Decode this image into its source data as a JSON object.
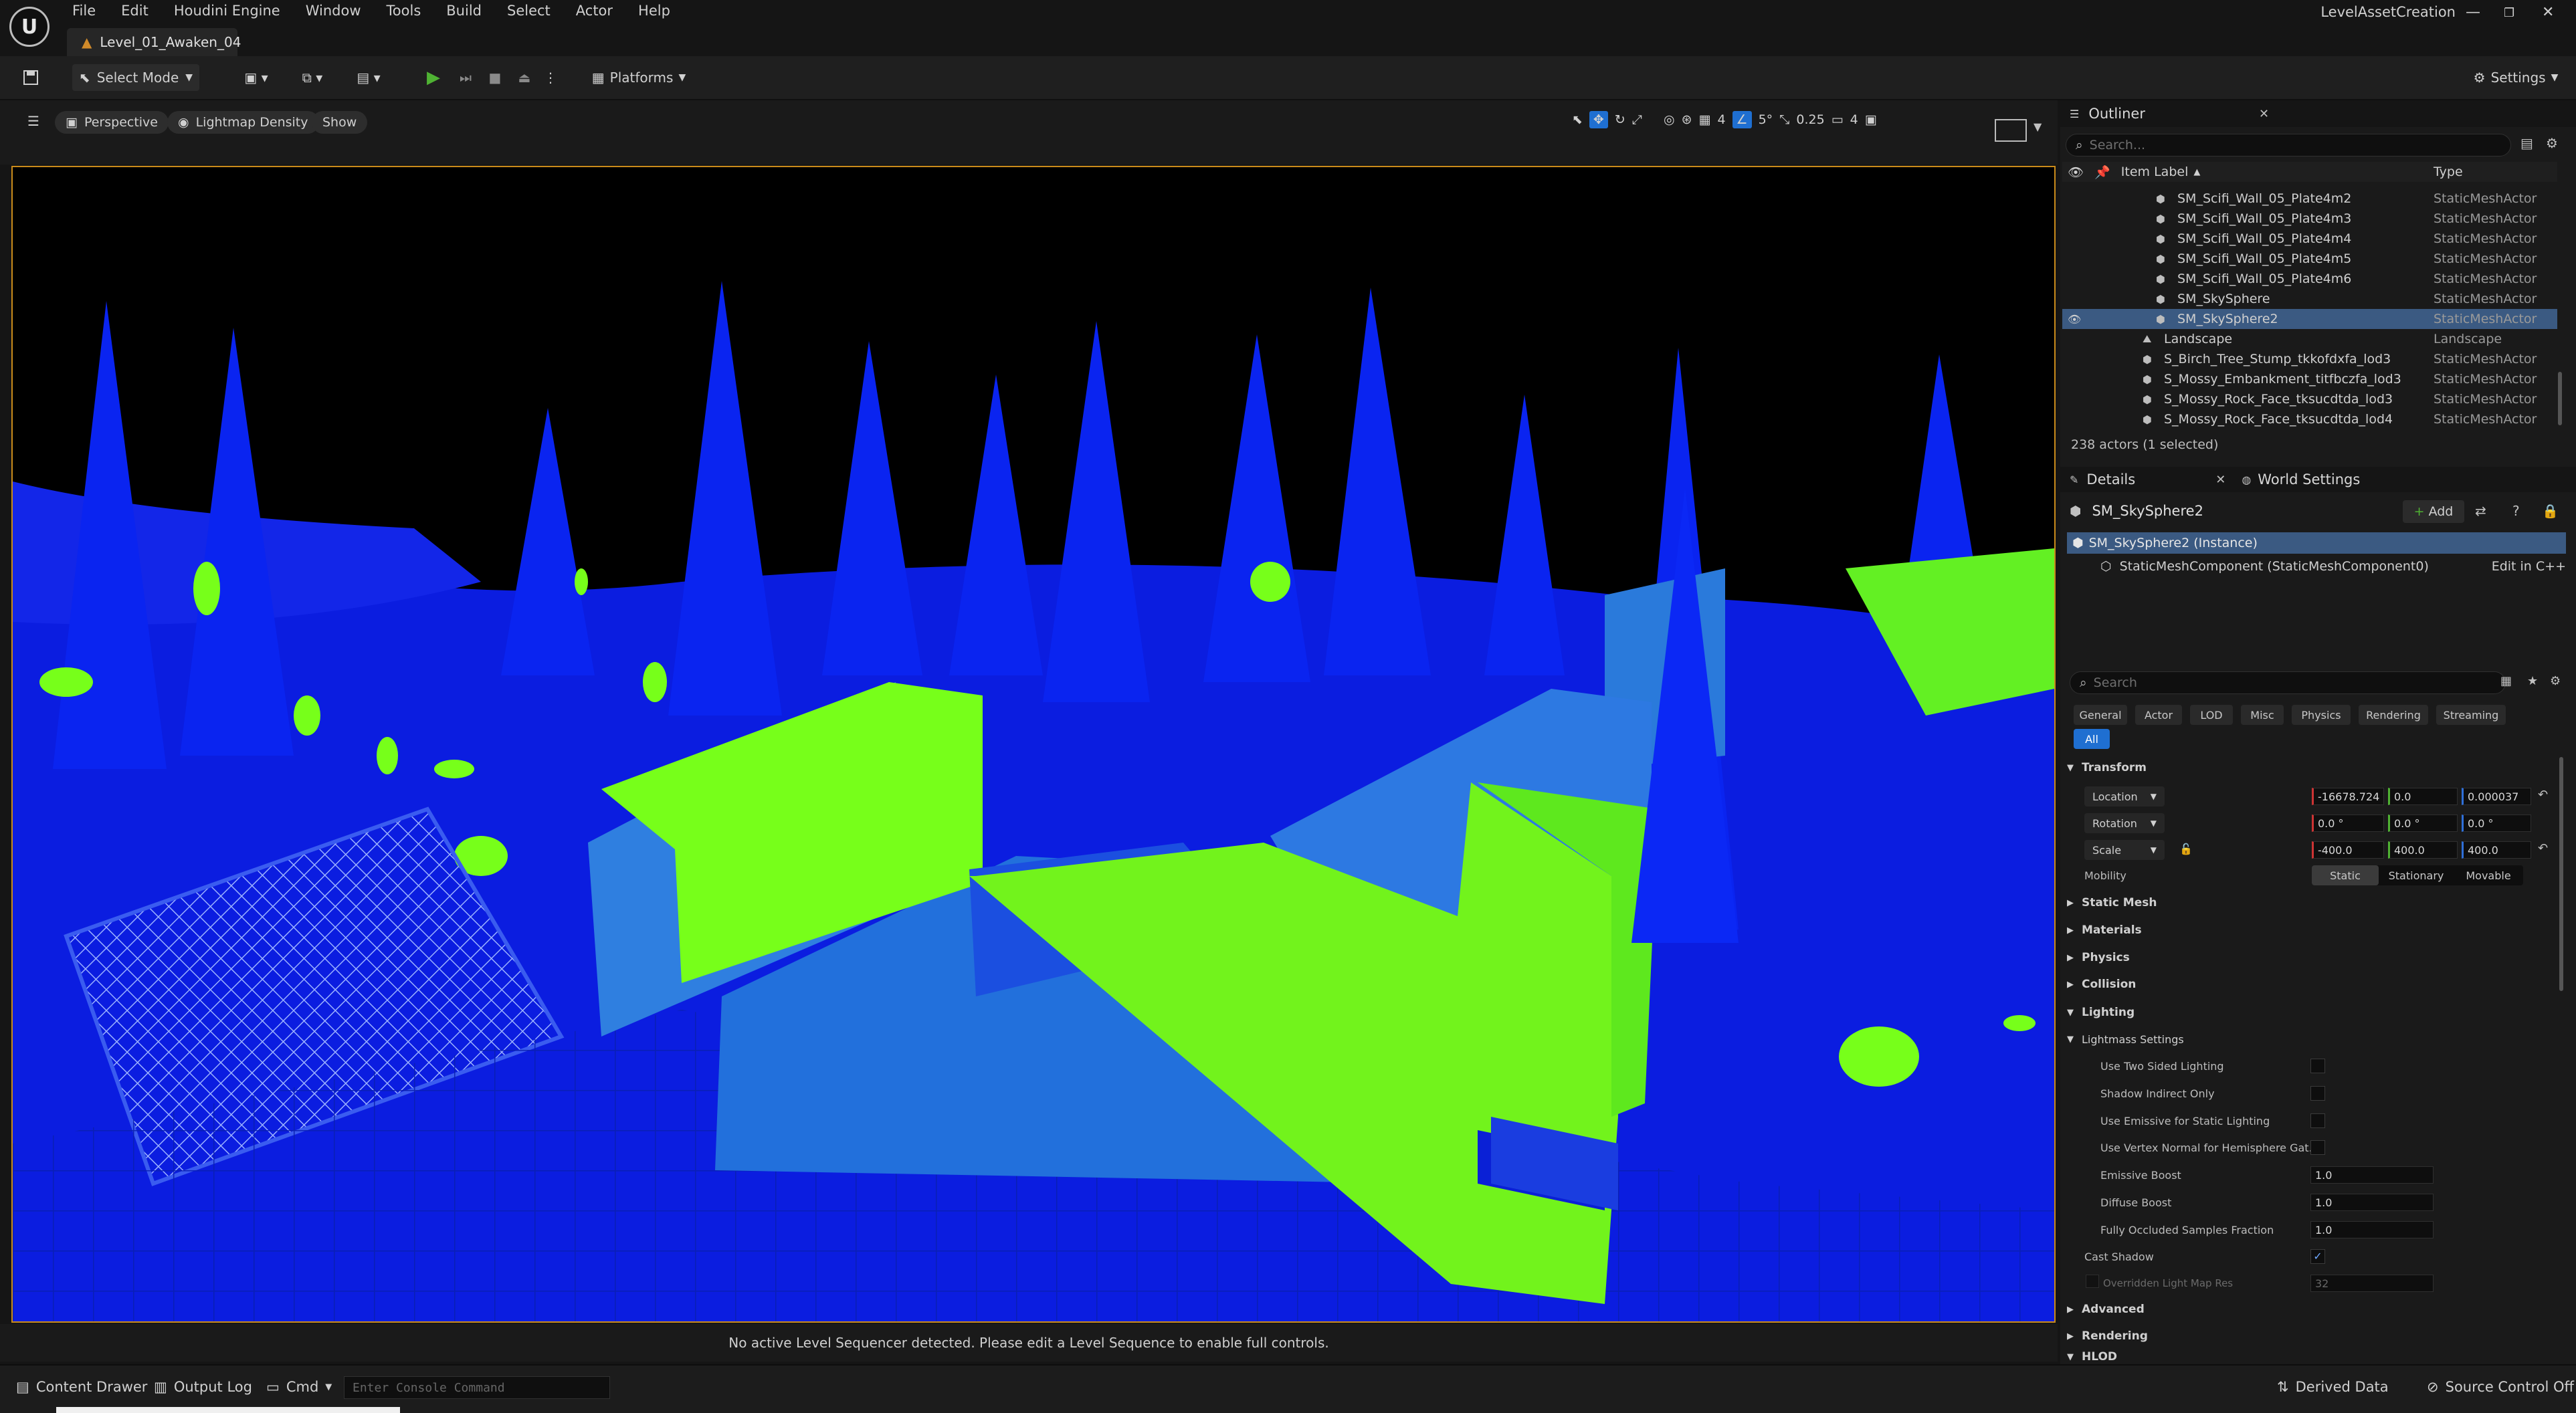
{
  "app": {
    "level_tab": "Level_01_Awaken_04",
    "project_name": "LevelAssetCreation",
    "menu": [
      "File",
      "Edit",
      "Houdini Engine",
      "Window",
      "Tools",
      "Build",
      "Select",
      "Actor",
      "Help"
    ]
  },
  "toolbar": {
    "select_mode": "Select Mode",
    "platforms": "Platforms",
    "settings": "Settings"
  },
  "viewport": {
    "perspective": "Perspective",
    "view_mode": "Lightmap Density",
    "show": "Show",
    "grid_value": "4",
    "rotation_snap": "5°",
    "scale_snap": "0.25",
    "camera_speed": "4",
    "footer_message": "No active Level Sequencer detected. Please edit a Level Sequence to enable full controls."
  },
  "outliner": {
    "title": "Outliner",
    "search_placeholder": "Search...",
    "col_label": "Item Label",
    "col_type": "Type",
    "rows": [
      {
        "label": "SM_Scifi_Wall_05_Plate4m2",
        "type": "StaticMeshActor",
        "indent": 1
      },
      {
        "label": "SM_Scifi_Wall_05_Plate4m3",
        "type": "StaticMeshActor",
        "indent": 1
      },
      {
        "label": "SM_Scifi_Wall_05_Plate4m4",
        "type": "StaticMeshActor",
        "indent": 1
      },
      {
        "label": "SM_Scifi_Wall_05_Plate4m5",
        "type": "StaticMeshActor",
        "indent": 1
      },
      {
        "label": "SM_Scifi_Wall_05_Plate4m6",
        "type": "StaticMeshActor",
        "indent": 1
      },
      {
        "label": "SM_SkySphere",
        "type": "StaticMeshActor",
        "indent": 1
      },
      {
        "label": "SM_SkySphere2",
        "type": "StaticMeshActor",
        "indent": 1,
        "selected": true
      },
      {
        "label": "Landscape",
        "type": "Landscape",
        "indent": 0
      },
      {
        "label": "S_Birch_Tree_Stump_tkkofdxfa_lod3",
        "type": "StaticMeshActor",
        "indent": 0
      },
      {
        "label": "S_Mossy_Embankment_titfbczfa_lod3",
        "type": "StaticMeshActor",
        "indent": 0
      },
      {
        "label": "S_Mossy_Rock_Face_tksucdtda_lod3",
        "type": "StaticMeshActor",
        "indent": 0
      },
      {
        "label": "S_Mossy_Rock_Face_tksucdtda_lod4",
        "type": "StaticMeshActor",
        "indent": 0
      }
    ],
    "actor_count": "238 actors (1 selected)"
  },
  "details": {
    "tab_details": "Details",
    "tab_world": "World Settings",
    "object_name": "SM_SkySphere2",
    "add_label": "Add",
    "instance_label": "SM_SkySphere2 (Instance)",
    "component_label": "StaticMeshComponent (StaticMeshComponent0)",
    "edit_cpp": "Edit in C++",
    "search_placeholder": "Search",
    "categories": [
      "General",
      "Actor",
      "LOD",
      "Misc",
      "Physics",
      "Rendering",
      "Streaming"
    ],
    "all_label": "All",
    "transform": {
      "title": "Transform",
      "location_label": "Location",
      "location": [
        "-16678.724",
        "0.0",
        "0.000037"
      ],
      "rotation_label": "Rotation",
      "rotation": [
        "0.0 °",
        "0.0 °",
        "0.0 °"
      ],
      "scale_label": "Scale",
      "scale": [
        "-400.0",
        "400.0",
        "400.0"
      ],
      "mobility_label": "Mobility",
      "mobility": [
        "Static",
        "Stationary",
        "Movable"
      ],
      "mobility_selected": "Static"
    },
    "sections": [
      "Static Mesh",
      "Materials",
      "Physics",
      "Collision"
    ],
    "lighting": {
      "title": "Lighting",
      "lightmass_title": "Lightmass Settings",
      "two_sided": "Use Two Sided Lighting",
      "shadow_indirect": "Shadow Indirect Only",
      "emissive_static": "Use Emissive for Static Lighting",
      "vertex_normal": "Use Vertex Normal for Hemisphere Gat...",
      "emissive_boost": "Emissive Boost",
      "emissive_boost_val": "1.0",
      "diffuse_boost": "Diffuse Boost",
      "diffuse_boost_val": "1.0",
      "occluded_fraction": "Fully Occluded Samples Fraction",
      "occluded_fraction_val": "1.0",
      "cast_shadow": "Cast Shadow",
      "overridden_res": "Overridden Light Map Res",
      "overridden_res_val": "32"
    },
    "bottom_sections": [
      "Advanced",
      "Rendering",
      "HLOD"
    ]
  },
  "statusbar": {
    "content_drawer": "Content Drawer",
    "output_log": "Output Log",
    "cmd": "Cmd",
    "console_placeholder": "Enter Console Command",
    "derived_data": "Derived Data",
    "source_control": "Source Control Off"
  },
  "colors": {
    "accent_blue": "#1f6fd1",
    "selection": "#3b5a82",
    "play_green": "#4fb233",
    "viewport_border": "#c98a1a",
    "lm_blue": "#0a17d6",
    "lm_green": "#77ff1a"
  }
}
